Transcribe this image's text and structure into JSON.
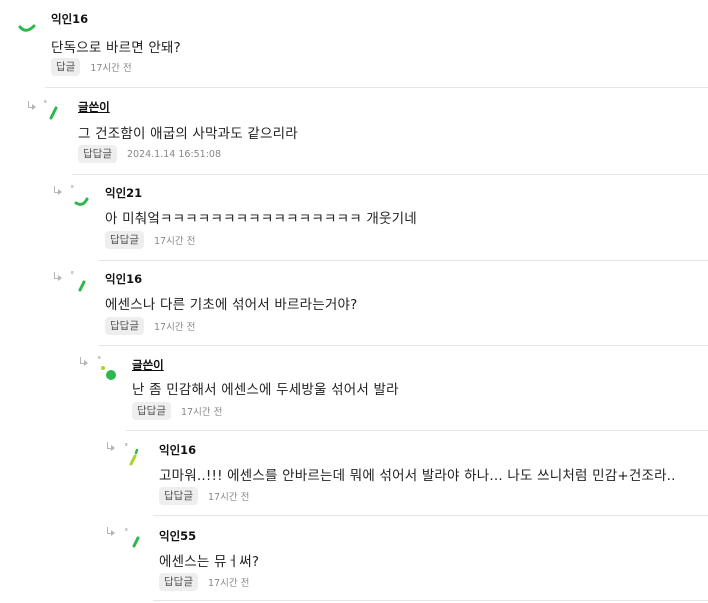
{
  "comments": [
    {
      "nickname": "익인16",
      "text": "단독으로 바르면 안돼?",
      "reply_label": "답글",
      "time": "17시간 전",
      "is_author": false
    },
    {
      "nickname": "글쓴이",
      "text": "그 건조함이 애굽의 사막과도 같으리라",
      "reply_label": "답답글",
      "time": "2024.1.14 16:51:08",
      "is_author": true
    },
    {
      "nickname": "익인21",
      "text": "아 미춰엌ㅋㅋㅋㅋㅋㅋㅋㅋㅋㅋㅋㅋㅋㅋㅋㅋ 개웃기네",
      "reply_label": "답답글",
      "time": "17시간 전",
      "is_author": false
    },
    {
      "nickname": "익인16",
      "text": "에센스나 다른 기초에 섞어서 바르라는거야?",
      "reply_label": "답답글",
      "time": "17시간 전",
      "is_author": false
    },
    {
      "nickname": "글쓴이",
      "text": "난 좀 민감해서 에센스에 두세방울 섞어서 발라",
      "reply_label": "답답글",
      "time": "17시간 전",
      "is_author": true
    },
    {
      "nickname": "익인16",
      "text": "고마워..!!! 에센스를 안바르는데 뭐에 섞어서 발라야 하나... 나도 쓰니처럼 민감+건조라..",
      "reply_label": "답답글",
      "time": "17시간 전",
      "is_author": false
    },
    {
      "nickname": "익인55",
      "text": "에센스는 뮤ㅓ써?",
      "reply_label": "답답글",
      "time": "17시간 전",
      "is_author": false
    }
  ],
  "colors": {
    "green": "#2db84d",
    "lime": "#a8d42a",
    "divider": "#e6e6e6"
  },
  "icons": {
    "reply_arrow": "reply-arrow-icon",
    "avatar": "avatar-icon"
  }
}
